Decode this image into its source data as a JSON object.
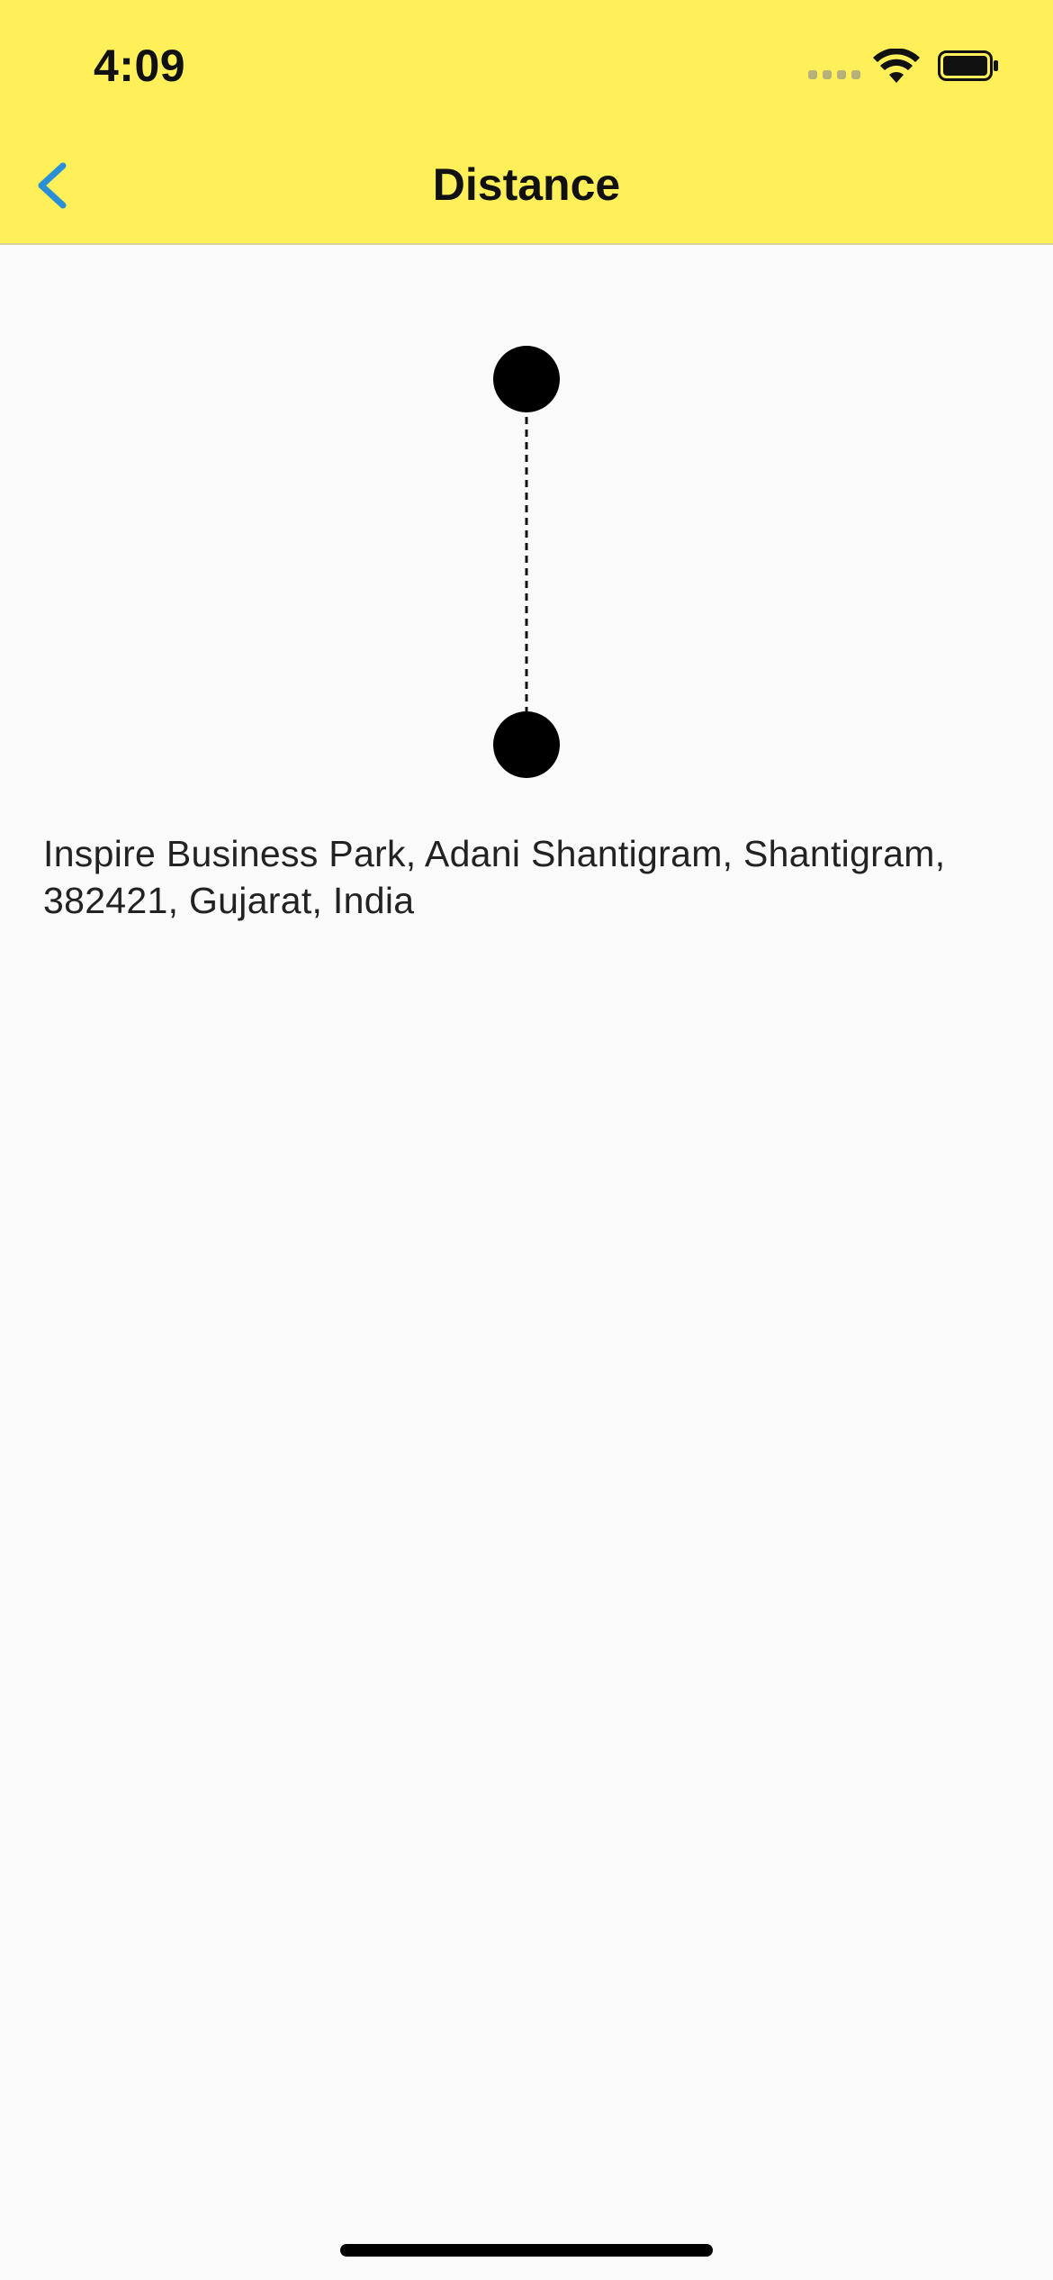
{
  "status_bar": {
    "time": "4:09"
  },
  "nav": {
    "title": "Distance",
    "back_icon": "chevron-left-icon"
  },
  "route": {
    "start_marker": "dot",
    "end_marker": "dot",
    "connector": "dashed-line"
  },
  "address": "Inspire Business Park, Adani Shantigram, Shantigram, 382421, Gujarat, India",
  "colors": {
    "header_bg": "#fff05a",
    "page_bg": "#fafafa",
    "accent": "#2b8fd8",
    "marker": "#000000"
  }
}
